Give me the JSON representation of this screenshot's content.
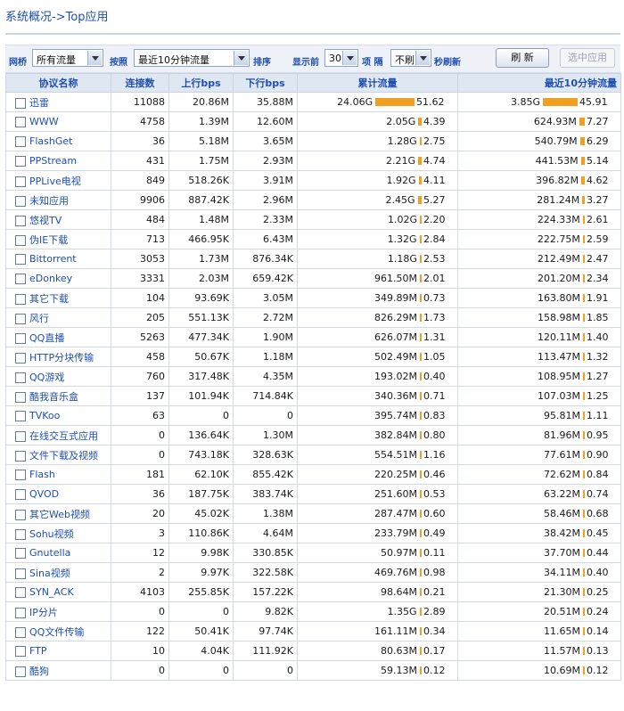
{
  "title": "系统概况->Top应用",
  "toolbar": {
    "bridge_label": "网桥",
    "bridge_value": "所有流量",
    "by_label": "按照",
    "sort_value": "最近10分钟流量",
    "sort_suffix": "排序",
    "show_label": "显示前",
    "show_value": "30",
    "items_label": "项 隔",
    "refresh_value": "不刷",
    "refresh_suffix": "秒刷新",
    "refresh_button": "刷  新",
    "apply_button": "选中应用"
  },
  "columns": {
    "name": "协议名称",
    "conn": "连接数",
    "up": "上行bps",
    "down": "下行bps",
    "total": "累计流量",
    "recent": "最近10分钟流量"
  },
  "colors": {
    "bar": "#f0a020",
    "header_text": "#1f4fb0",
    "header_bg": "#dfe7f3"
  },
  "rows": [
    {
      "name": "迅雷",
      "conn": "11088",
      "up": "20.86M",
      "down": "35.88M",
      "total": "24.06G",
      "total_pct": "51.62",
      "recent": "3.85G",
      "recent_pct": "45.91"
    },
    {
      "name": "WWW",
      "conn": "4758",
      "up": "1.39M",
      "down": "12.60M",
      "total": "2.05G",
      "total_pct": "4.39",
      "recent": "624.93M",
      "recent_pct": "7.27"
    },
    {
      "name": "FlashGet",
      "conn": "36",
      "up": "5.18M",
      "down": "3.65M",
      "total": "1.28G",
      "total_pct": "2.75",
      "recent": "540.79M",
      "recent_pct": "6.29"
    },
    {
      "name": "PPStream",
      "conn": "431",
      "up": "1.75M",
      "down": "2.93M",
      "total": "2.21G",
      "total_pct": "4.74",
      "recent": "441.53M",
      "recent_pct": "5.14"
    },
    {
      "name": "PPLive电视",
      "conn": "849",
      "up": "518.26K",
      "down": "3.91M",
      "total": "1.92G",
      "total_pct": "4.11",
      "recent": "396.82M",
      "recent_pct": "4.62"
    },
    {
      "name": "未知应用",
      "conn": "9906",
      "up": "887.42K",
      "down": "2.96M",
      "total": "2.45G",
      "total_pct": "5.27",
      "recent": "281.24M",
      "recent_pct": "3.27"
    },
    {
      "name": "悠视TV",
      "conn": "484",
      "up": "1.48M",
      "down": "2.33M",
      "total": "1.02G",
      "total_pct": "2.20",
      "recent": "224.33M",
      "recent_pct": "2.61"
    },
    {
      "name": "伪IE下载",
      "conn": "713",
      "up": "466.95K",
      "down": "6.43M",
      "total": "1.32G",
      "total_pct": "2.84",
      "recent": "222.75M",
      "recent_pct": "2.59"
    },
    {
      "name": "Bittorrent",
      "conn": "3053",
      "up": "1.73M",
      "down": "876.34K",
      "total": "1.18G",
      "total_pct": "2.53",
      "recent": "212.49M",
      "recent_pct": "2.47"
    },
    {
      "name": "eDonkey",
      "conn": "3331",
      "up": "2.03M",
      "down": "659.42K",
      "total": "961.50M",
      "total_pct": "2.01",
      "recent": "201.20M",
      "recent_pct": "2.34"
    },
    {
      "name": "其它下载",
      "conn": "104",
      "up": "93.69K",
      "down": "3.05M",
      "total": "349.89M",
      "total_pct": "0.73",
      "recent": "163.80M",
      "recent_pct": "1.91"
    },
    {
      "name": "风行",
      "conn": "205",
      "up": "551.13K",
      "down": "2.72M",
      "total": "826.29M",
      "total_pct": "1.73",
      "recent": "158.98M",
      "recent_pct": "1.85"
    },
    {
      "name": "QQ直播",
      "conn": "5263",
      "up": "477.34K",
      "down": "1.90M",
      "total": "626.07M",
      "total_pct": "1.31",
      "recent": "120.11M",
      "recent_pct": "1.40"
    },
    {
      "name": "HTTP分块传输",
      "conn": "458",
      "up": "50.67K",
      "down": "1.18M",
      "total": "502.49M",
      "total_pct": "1.05",
      "recent": "113.47M",
      "recent_pct": "1.32"
    },
    {
      "name": "QQ游戏",
      "conn": "760",
      "up": "317.48K",
      "down": "4.35M",
      "total": "193.02M",
      "total_pct": "0.40",
      "recent": "108.95M",
      "recent_pct": "1.27"
    },
    {
      "name": "酷我音乐盒",
      "conn": "137",
      "up": "101.94K",
      "down": "714.84K",
      "total": "340.36M",
      "total_pct": "0.71",
      "recent": "107.03M",
      "recent_pct": "1.25"
    },
    {
      "name": "TVKoo",
      "conn": "63",
      "up": "0",
      "down": "0",
      "total": "395.74M",
      "total_pct": "0.83",
      "recent": "95.81M",
      "recent_pct": "1.11"
    },
    {
      "name": "在线交互式应用",
      "conn": "0",
      "up": "136.64K",
      "down": "1.30M",
      "total": "382.84M",
      "total_pct": "0.80",
      "recent": "81.96M",
      "recent_pct": "0.95"
    },
    {
      "name": "文件下载及视频",
      "conn": "0",
      "up": "743.18K",
      "down": "328.63K",
      "total": "554.51M",
      "total_pct": "1.16",
      "recent": "77.61M",
      "recent_pct": "0.90"
    },
    {
      "name": "Flash",
      "conn": "181",
      "up": "62.10K",
      "down": "855.42K",
      "total": "220.25M",
      "total_pct": "0.46",
      "recent": "72.62M",
      "recent_pct": "0.84"
    },
    {
      "name": "QVOD",
      "conn": "36",
      "up": "187.75K",
      "down": "383.74K",
      "total": "251.60M",
      "total_pct": "0.53",
      "recent": "63.22M",
      "recent_pct": "0.74"
    },
    {
      "name": "其它Web视频",
      "conn": "20",
      "up": "45.02K",
      "down": "1.38M",
      "total": "287.47M",
      "total_pct": "0.60",
      "recent": "58.46M",
      "recent_pct": "0.68"
    },
    {
      "name": "Sohu视频",
      "conn": "3",
      "up": "110.86K",
      "down": "4.64M",
      "total": "233.79M",
      "total_pct": "0.49",
      "recent": "38.42M",
      "recent_pct": "0.45"
    },
    {
      "name": "Gnutella",
      "conn": "12",
      "up": "9.98K",
      "down": "330.85K",
      "total": "50.97M",
      "total_pct": "0.11",
      "recent": "37.70M",
      "recent_pct": "0.44"
    },
    {
      "name": "Sina视频",
      "conn": "2",
      "up": "9.97K",
      "down": "322.58K",
      "total": "469.76M",
      "total_pct": "0.98",
      "recent": "34.11M",
      "recent_pct": "0.40"
    },
    {
      "name": "SYN_ACK",
      "conn": "4103",
      "up": "255.85K",
      "down": "157.22K",
      "total": "98.64M",
      "total_pct": "0.21",
      "recent": "21.30M",
      "recent_pct": "0.25"
    },
    {
      "name": "IP分片",
      "conn": "0",
      "up": "0",
      "down": "9.82K",
      "total": "1.35G",
      "total_pct": "2.89",
      "recent": "20.51M",
      "recent_pct": "0.24"
    },
    {
      "name": "QQ文件传输",
      "conn": "122",
      "up": "50.41K",
      "down": "97.74K",
      "total": "161.11M",
      "total_pct": "0.34",
      "recent": "11.65M",
      "recent_pct": "0.14"
    },
    {
      "name": "FTP",
      "conn": "10",
      "up": "4.04K",
      "down": "111.92K",
      "total": "80.63M",
      "total_pct": "0.17",
      "recent": "11.57M",
      "recent_pct": "0.13"
    },
    {
      "name": "酷狗",
      "conn": "0",
      "up": "0",
      "down": "0",
      "total": "59.13M",
      "total_pct": "0.12",
      "recent": "10.69M",
      "recent_pct": "0.12"
    }
  ]
}
